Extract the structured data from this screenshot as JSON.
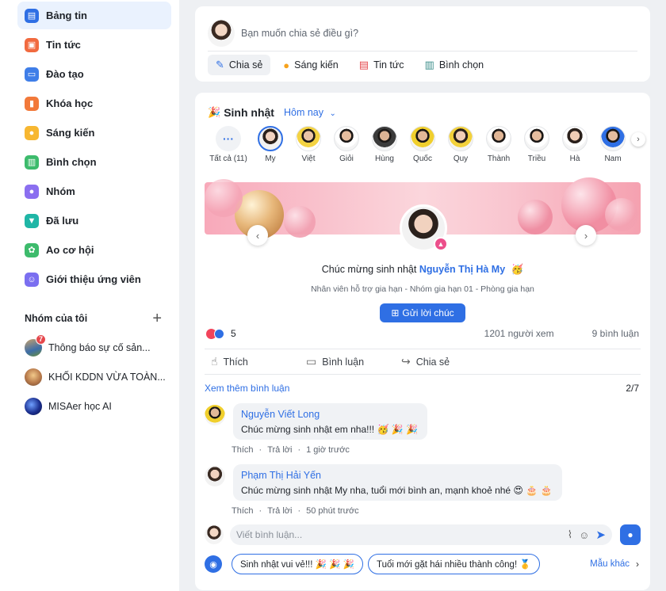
{
  "sidebar": {
    "items": [
      {
        "label": "Bảng tin",
        "icon": "newsfeed-icon",
        "color": "#2f6fe4"
      },
      {
        "label": "Tin tức",
        "icon": "news-icon",
        "color": "#f16a3f"
      },
      {
        "label": "Đào tạo",
        "icon": "training-icon",
        "color": "#3f7ee8"
      },
      {
        "label": "Khóa học",
        "icon": "course-icon",
        "color": "#f2793a"
      },
      {
        "label": "Sáng kiến",
        "icon": "idea-icon",
        "color": "#f7b731"
      },
      {
        "label": "Bình chọn",
        "icon": "poll-icon",
        "color": "#3dbb6c"
      },
      {
        "label": "Nhóm",
        "icon": "group-icon",
        "color": "#8b6ff0"
      },
      {
        "label": "Đã lưu",
        "icon": "bookmark-icon",
        "color": "#1fb6a6"
      },
      {
        "label": "Ao cơ hội",
        "icon": "opportunity-icon",
        "color": "#3dbb6c"
      },
      {
        "label": "Giới thiệu ứng viên",
        "icon": "referral-icon",
        "color": "#7b6ff0"
      }
    ],
    "groups_title": "Nhóm của tôi",
    "groups": [
      {
        "label": "Thông báo sự cố sản...",
        "badge": "7"
      },
      {
        "label": "KHỐI KDDN VỪA TOÀN..."
      },
      {
        "label": "MISAer học AI"
      }
    ]
  },
  "composer": {
    "placeholder": "Bạn muốn chia sẻ điều gì?",
    "actions": [
      {
        "label": "Chia sẻ",
        "icon": "share-edit-icon"
      },
      {
        "label": "Sáng kiến",
        "icon": "lightbulb-icon"
      },
      {
        "label": "Tin tức",
        "icon": "news-doc-icon"
      },
      {
        "label": "Bình chọn",
        "icon": "poll-chart-icon"
      }
    ]
  },
  "birthday": {
    "title": "Sinh nhật",
    "filter": "Hôm nay",
    "all_label": "Tất cả (11)",
    "people": [
      "My",
      "Việt",
      "Giỏi",
      "Hùng",
      "Quốc",
      "Quy",
      "Thành",
      "Triều",
      "Hà",
      "Nam"
    ],
    "wish_prefix": "Chúc mừng sinh nhật",
    "wish_name": "Nguyễn Thị Hà My",
    "subtitle": "Nhân viên hỗ trợ gia hạn - Nhóm gia hạn 01 - Phòng gia hạn",
    "send_label": "Gửi lời chúc",
    "reaction_count": "5",
    "views": "1201 người xem",
    "comments_count": "9 bình luận"
  },
  "post_actions": {
    "like": "Thích",
    "comment": "Bình luận",
    "share": "Chia sẻ"
  },
  "comments": {
    "more_label": "Xem thêm bình luận",
    "pager": "2/7",
    "items": [
      {
        "author": "Nguyễn Viết Long",
        "text": "Chúc mừng sinh nhật em nha!!! 🥳 🎉 🎉",
        "like": "Thích",
        "reply": "Trả lời",
        "time": "1 giờ trước"
      },
      {
        "author": "Phạm Thị Hải Yến",
        "text": "Chúc mừng sinh nhật My nha, tuổi mới bình an, mạnh khoẻ nhé 😍 🎂 🎂",
        "like": "Thích",
        "reply": "Trả lời",
        "time": "50 phút trước"
      }
    ],
    "input_placeholder": "Viết bình luận..."
  },
  "suggestions": {
    "chips": [
      "Sinh nhật vui vẻ!!! 🎉 🎉 🎉",
      "Tuổi mới gặt hái nhiều thành công! 🥇"
    ],
    "more_label": "Mẫu khác"
  },
  "dots": "···",
  "colors": {
    "primary": "#2f6fe4",
    "active_bg": "#eaf2fe",
    "badge": "#e5484d"
  }
}
